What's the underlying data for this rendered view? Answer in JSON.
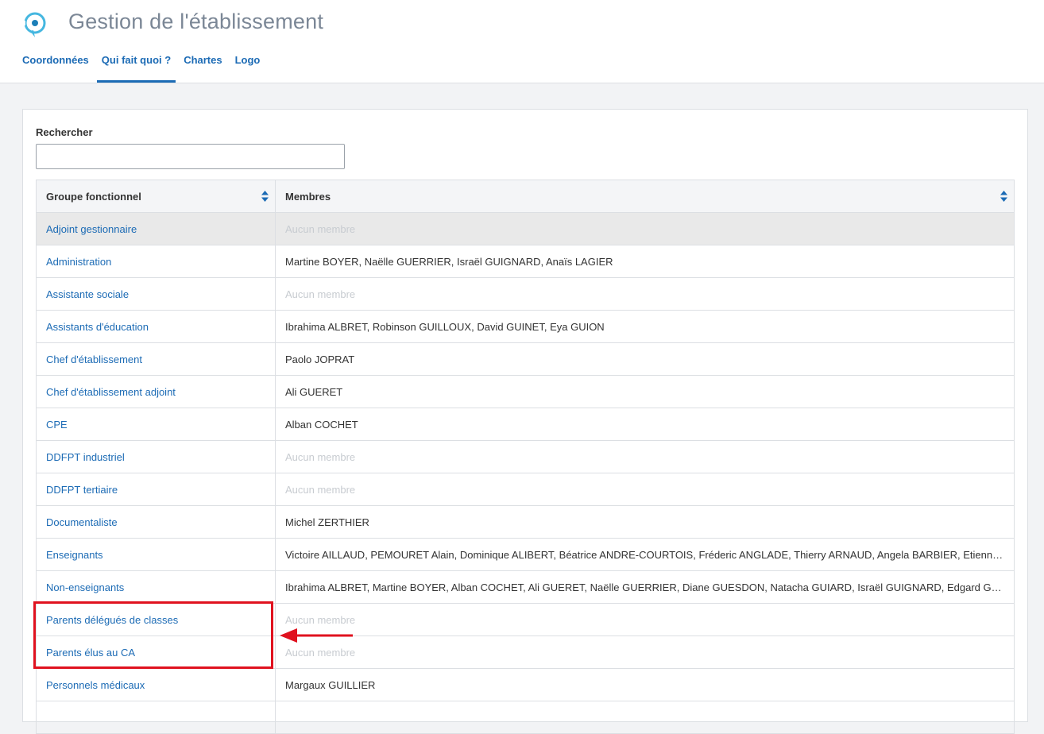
{
  "app": {
    "icon": "location-pin-icon",
    "title": "Gestion de l'établissement"
  },
  "tabs": [
    {
      "label": "Coordonnées",
      "active": false
    },
    {
      "label": "Qui fait quoi ?",
      "active": true
    },
    {
      "label": "Chartes",
      "active": false
    },
    {
      "label": "Logo",
      "active": false
    }
  ],
  "search": {
    "label": "Rechercher",
    "value": "",
    "placeholder": ""
  },
  "table": {
    "headers": {
      "group": "Groupe fonctionnel",
      "members": "Membres"
    },
    "rows": [
      {
        "group": "Adjoint gestionnaire",
        "members": "Aucun membre",
        "empty": true
      },
      {
        "group": "Administration",
        "members": "Martine BOYER, Naëlle GUERRIER, Israël GUIGNARD, Anaïs LAGIER",
        "empty": false
      },
      {
        "group": "Assistante sociale",
        "members": "Aucun membre",
        "empty": true
      },
      {
        "group": "Assistants d'éducation",
        "members": "Ibrahima ALBRET, Robinson GUILLOUX, David GUINET, Eya GUION",
        "empty": false
      },
      {
        "group": "Chef d'établissement",
        "members": "Paolo JOPRAT",
        "empty": false
      },
      {
        "group": "Chef d'établissement adjoint",
        "members": "Ali GUERET",
        "empty": false
      },
      {
        "group": "CPE",
        "members": "Alban COCHET",
        "empty": false
      },
      {
        "group": "DDFPT industriel",
        "members": "Aucun membre",
        "empty": true
      },
      {
        "group": "DDFPT tertiaire",
        "members": "Aucun membre",
        "empty": true
      },
      {
        "group": "Documentaliste",
        "members": "Michel ZERTHIER",
        "empty": false
      },
      {
        "group": "Enseignants",
        "members": "Victoire AILLAUD, PEMOURET Alain, Dominique ALIBERT, Béatrice ANDRE-COURTOIS, Fréderic ANGLADE, Thierry ARNAUD, Angela BARBIER, Etienne …",
        "empty": false
      },
      {
        "group": "Non-enseignants",
        "members": "Ibrahima ALBRET, Martine BOYER, Alban COCHET, Ali GUERET, Naëlle GUERRIER, Diane GUESDON, Natacha GUIARD, Israël GUIGNARD, Edgard GUILB…",
        "empty": false
      },
      {
        "group": "Parents délégués de classes",
        "members": "Aucun membre",
        "empty": true
      },
      {
        "group": "Parents élus au CA",
        "members": "Aucun membre",
        "empty": true
      },
      {
        "group": "Personnels médicaux",
        "members": "Margaux GUILLIER",
        "empty": false
      },
      {
        "group": "",
        "members": "",
        "empty": false
      }
    ]
  },
  "colors": {
    "accent": "#1c6bb5",
    "title": "#7b8796",
    "annotation": "#e0121f",
    "empty_text": "#c8ccd1",
    "row_highlight": "#e9e9e9"
  },
  "annotation": {
    "box_icon": "highlight-rectangle",
    "arrow_icon": "arrow-left-icon"
  }
}
